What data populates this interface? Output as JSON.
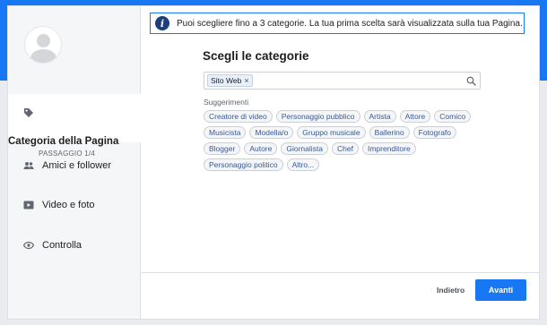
{
  "info_banner": {
    "text": "Puoi scegliere fino a 3 categorie. La tua prima scelta sarà visualizzata sulla tua Pagina.",
    "icon": "info-icon"
  },
  "sidebar": {
    "active_step": {
      "title": "Categoria della Pagina",
      "subtitle": "PASSAGGIO 1/4",
      "icon": "tag-icon"
    },
    "items": [
      {
        "label": "Amici e follower",
        "icon": "people-icon"
      },
      {
        "label": "Video e foto",
        "icon": "video-icon"
      },
      {
        "label": "Controlla",
        "icon": "eye-icon"
      }
    ]
  },
  "main": {
    "heading": "Scegli le categorie",
    "selected_token": "Sito Web",
    "suggestions_label": "Suggerimenti",
    "suggestions_rows": [
      [
        "Creatore di video",
        "Personaggio pubblico",
        "Artista",
        "Attore",
        "Comico"
      ],
      [
        "Musicista",
        "Modella/o",
        "Gruppo musicale",
        "Ballerino",
        "Fotografo"
      ],
      [
        "Blogger",
        "Autore",
        "Giornalista",
        "Chef",
        "Imprenditore"
      ],
      [
        "Personaggio politico",
        "Altro..."
      ]
    ]
  },
  "footer": {
    "back_label": "Indietro",
    "next_label": "Avanti"
  },
  "colors": {
    "brand_blue": "#1877f2",
    "chip_text": "#385898"
  }
}
